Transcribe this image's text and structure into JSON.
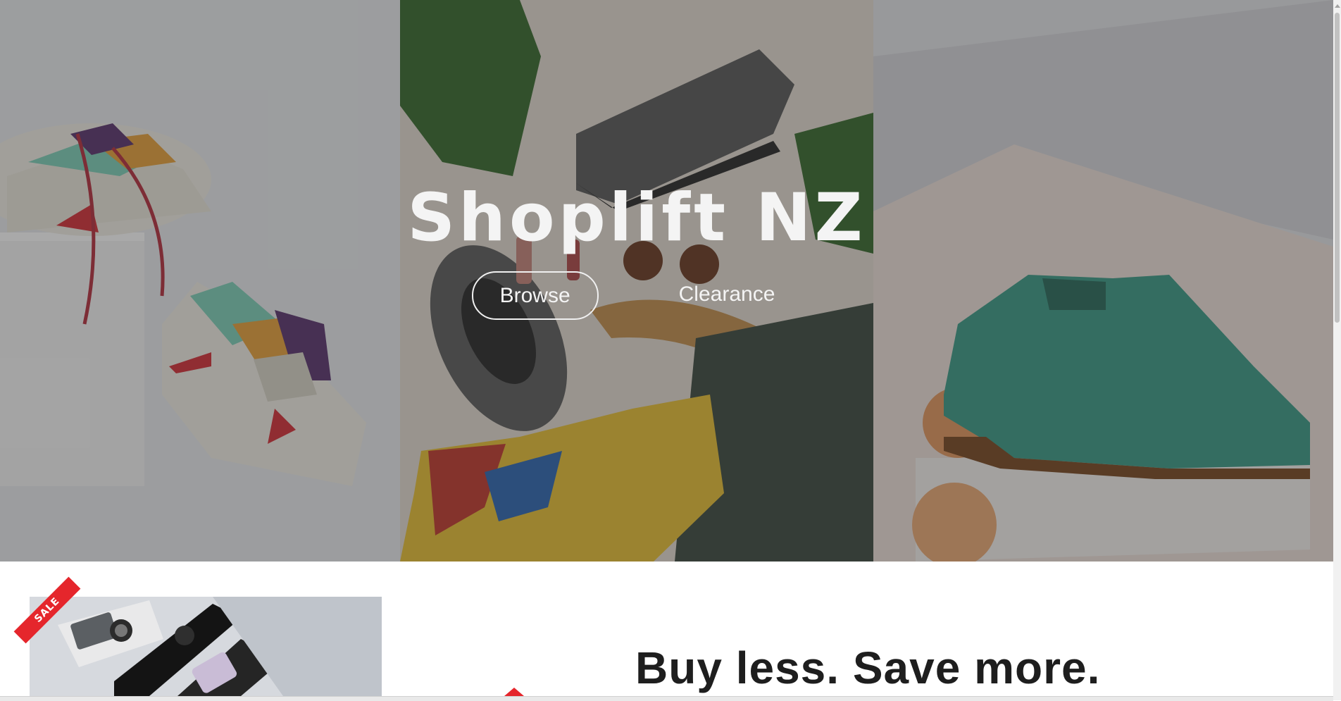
{
  "hero": {
    "title": "Shoplift NZ",
    "buttons": [
      {
        "label": "Browse",
        "style": "outlined"
      },
      {
        "label": "Clearance",
        "style": "text"
      }
    ]
  },
  "promo": {
    "sale_badge": "SALE",
    "headline": "Buy less. Save more."
  },
  "colors": {
    "accent": "#e5262c",
    "overlay": "#282828",
    "text_dark": "#1e1e1e",
    "text_light": "#f4f4f4"
  }
}
